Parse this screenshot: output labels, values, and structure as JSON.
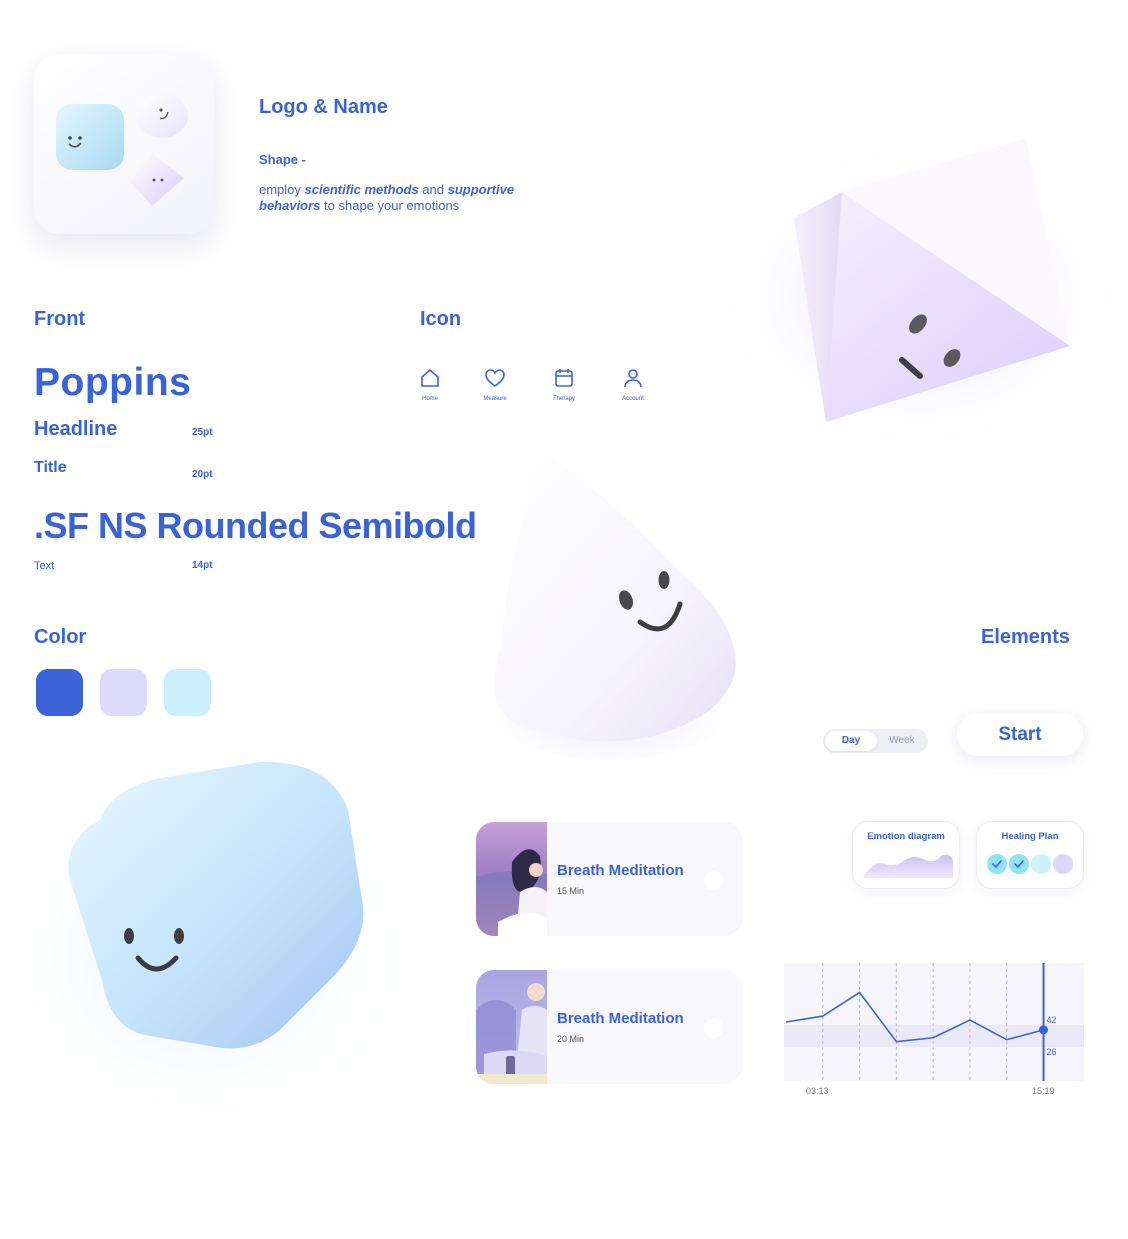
{
  "logo_section": {
    "title": "Logo & Name",
    "subtitle": "Shape -",
    "desc_part1": "employ ",
    "desc_em1": "scientific methods",
    "desc_part2": " and ",
    "desc_em2": "supportive behaviors",
    "desc_part3": " to shape your emotions"
  },
  "font_section": {
    "title": "Front",
    "font1": "Poppins",
    "headline_label": "Headline",
    "headline_size": "25pt",
    "title_label": "Title",
    "title_size": "20pt",
    "font2": ".SF NS Rounded Semibold",
    "text_label": "Text",
    "text_size": "14pt"
  },
  "icon_section": {
    "title": "Icon",
    "items": [
      {
        "label": "Home",
        "icon": "home-icon"
      },
      {
        "label": "Measure",
        "icon": "heart-icon"
      },
      {
        "label": "Therapy",
        "icon": "calendar-icon"
      },
      {
        "label": "Account",
        "icon": "user-icon"
      }
    ]
  },
  "color_section": {
    "title": "Color",
    "swatches": [
      "#3d63d8",
      "#dedbfa",
      "#cbf0fb"
    ]
  },
  "elements_section": {
    "title": "Elements",
    "toggle": {
      "day": "Day",
      "week": "Week",
      "selected": "Day"
    },
    "start_button": "Start",
    "meditations": [
      {
        "title": "Breath Meditation",
        "duration": "15 Min"
      },
      {
        "title": "Breath Meditation",
        "duration": "20 Min"
      }
    ],
    "emotion_card": "Emotion diagram",
    "healing_card": "Healing Plan",
    "healing_checked": 2,
    "healing_total": 4
  },
  "chart_data": {
    "type": "line",
    "x_labels": [
      "03:13",
      "15:19"
    ],
    "values": [
      30,
      33,
      45,
      20,
      22,
      31,
      21,
      26
    ],
    "highlight_labels": [
      "42",
      "26"
    ],
    "ylim": [
      0,
      60
    ]
  },
  "colors": {
    "accent": "#3b63d9",
    "lavender": "#dedbfa",
    "cyan": "#cbf0fb"
  }
}
